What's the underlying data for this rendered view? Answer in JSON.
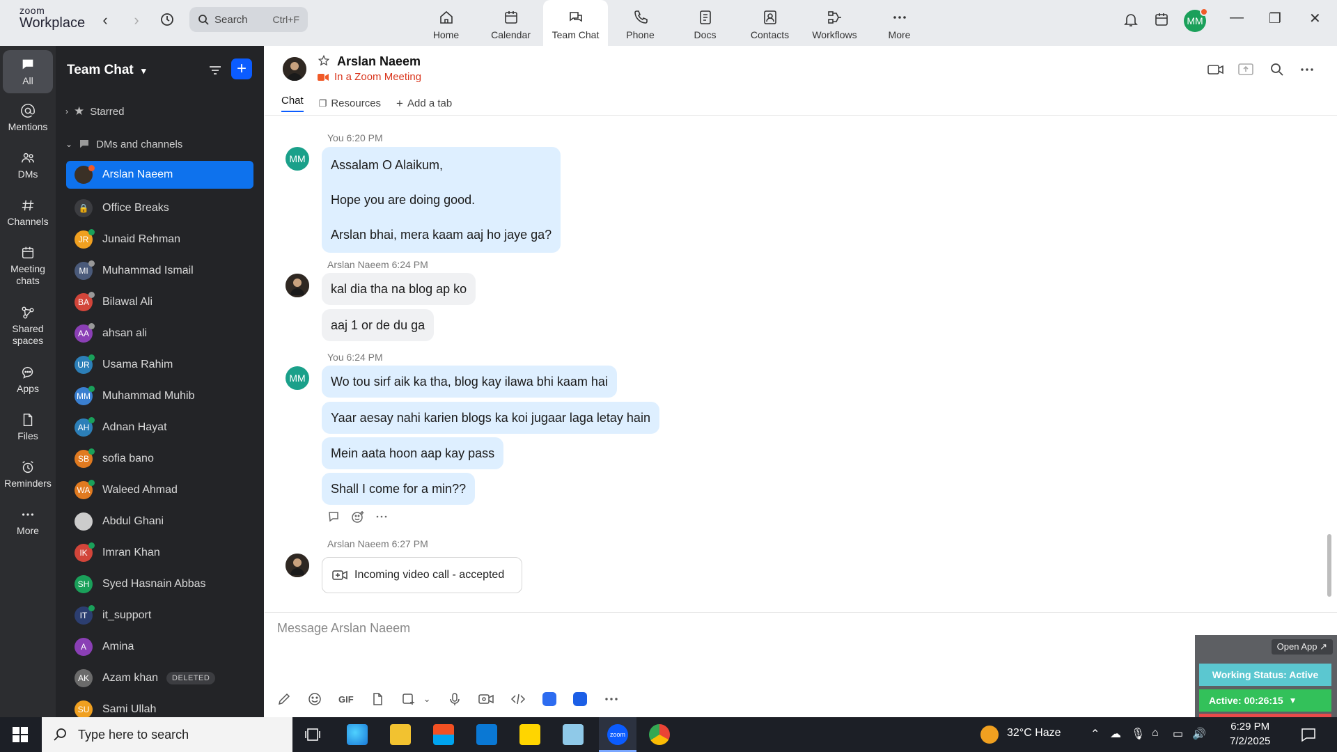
{
  "topbar": {
    "logo_line1": "zoom",
    "logo_line2": "Workplace",
    "search_label": "Search",
    "search_shortcut": "Ctrl+F",
    "tabs": [
      {
        "label": "Home",
        "icon": "home-icon"
      },
      {
        "label": "Calendar",
        "icon": "calendar-icon"
      },
      {
        "label": "Team Chat",
        "icon": "chat-icon",
        "active": true
      },
      {
        "label": "Phone",
        "icon": "phone-icon"
      },
      {
        "label": "Docs",
        "icon": "docs-icon"
      },
      {
        "label": "Contacts",
        "icon": "contacts-icon"
      },
      {
        "label": "Workflows",
        "icon": "workflows-icon"
      },
      {
        "label": "More",
        "icon": "more-icon"
      }
    ],
    "user_initials": "MM"
  },
  "rail": {
    "items": [
      {
        "label": "All",
        "icon": "all-chat-icon",
        "active": true
      },
      {
        "label": "Mentions",
        "icon": "at-icon"
      },
      {
        "label": "DMs",
        "icon": "people-icon"
      },
      {
        "label": "Channels",
        "icon": "hash-icon"
      },
      {
        "label": "Meeting",
        "label2": "chats",
        "icon": "meeting-chats-icon"
      },
      {
        "label": "Shared",
        "label2": "spaces",
        "icon": "shared-spaces-icon"
      },
      {
        "label": "Apps",
        "icon": "apps-icon"
      },
      {
        "label": "Files",
        "icon": "files-icon"
      },
      {
        "label": "Reminders",
        "icon": "alarm-icon"
      },
      {
        "label": "More",
        "icon": "more-dots-icon"
      }
    ]
  },
  "sidebar": {
    "title": "Team Chat",
    "starred_label": "Starred",
    "dms_label": "DMs and channels",
    "contacts": [
      {
        "name": "Arslan Naeem",
        "initials": "",
        "color": "#3a3026",
        "selected": true,
        "status": "#f05a28"
      },
      {
        "name": "Office Breaks",
        "initials": "🔒",
        "color": "#3c3d41",
        "status": ""
      },
      {
        "name": "Junaid Rehman",
        "initials": "JR",
        "color": "#f0a020",
        "status": "#1aa05a"
      },
      {
        "name": "Muhammad Ismail",
        "initials": "MI",
        "color": "#4a5a7a",
        "status": "#999"
      },
      {
        "name": "Bilawal Ali",
        "initials": "BA",
        "color": "#d2453a",
        "status": "#999"
      },
      {
        "name": "ahsan ali",
        "initials": "AA",
        "color": "#8a3fb5",
        "status": "#999"
      },
      {
        "name": "Usama Rahim",
        "initials": "UR",
        "color": "#2c7fb8",
        "status": "#1aa05a"
      },
      {
        "name": "Muhammad Muhib",
        "initials": "MM",
        "color": "#3a7fd0",
        "status": "#1aa05a"
      },
      {
        "name": "Adnan Hayat",
        "initials": "AH",
        "color": "#2c7fb8",
        "status": "#1aa05a"
      },
      {
        "name": "sofia bano",
        "initials": "SB",
        "color": "#e07a20",
        "status": "#1aa05a"
      },
      {
        "name": "Waleed Ahmad",
        "initials": "WA",
        "color": "#e07a20",
        "status": "#1aa05a"
      },
      {
        "name": "Abdul Ghani",
        "initials": "",
        "color": "#cccccc",
        "status": ""
      },
      {
        "name": "Imran Khan",
        "initials": "IK",
        "color": "#d2453a",
        "status": "#1aa05a"
      },
      {
        "name": "Syed Hasnain Abbas",
        "initials": "SH",
        "color": "#1aa05a",
        "status": ""
      },
      {
        "name": "it_support",
        "initials": "IT",
        "color": "#2c3e70",
        "status": "#1aa05a"
      },
      {
        "name": "Amina",
        "initials": "A",
        "color": "#8a3fb5",
        "status": ""
      },
      {
        "name": "Azam khan",
        "initials": "AK",
        "color": "#6b6b6b",
        "status": "",
        "badge": "DELETED"
      },
      {
        "name": "Sami Ullah",
        "initials": "SU",
        "color": "#f0a020",
        "status": ""
      }
    ]
  },
  "conversation": {
    "name": "Arslan Naeem",
    "status": "In a Zoom Meeting",
    "tabs": [
      "Chat",
      "Resources",
      "Add a tab"
    ],
    "messages": {
      "m1_meta": "You 6:20 PM",
      "m1_lines": [
        "Assalam O Alaikum,",
        "Hope you are doing good.",
        "Arslan bhai, mera kaam aaj ho jaye ga?"
      ],
      "m2_meta": "Arslan Naeem 6:24 PM",
      "m2_a": "kal dia tha na blog ap ko",
      "m2_b": "aaj 1 or de du ga",
      "m3_meta": "You 6:24 PM",
      "m3_a": "Wo tou sirf aik ka tha, blog kay ilawa bhi kaam hai",
      "m3_b": "Yaar aesay nahi karien blogs ka koi jugaar laga letay hain",
      "m3_c": "Mein aata hoon aap kay pass",
      "m3_d": "Shall I come for a min??",
      "m4_meta": "Arslan Naeem 6:27 PM",
      "m4_call": "Incoming video call - accepted"
    },
    "my_initials": "MM"
  },
  "composer": {
    "placeholder": "Message Arslan Naeem",
    "gif_label": "GIF"
  },
  "widget": {
    "open_app": "Open App ↗",
    "working_status": "Working Status: Active",
    "active_timer": "Active: 00:26:15"
  },
  "taskbar": {
    "search_placeholder": "Type here to search",
    "weather": "32°C  Haze",
    "time": "6:29 PM",
    "date": "7/2/2025"
  }
}
